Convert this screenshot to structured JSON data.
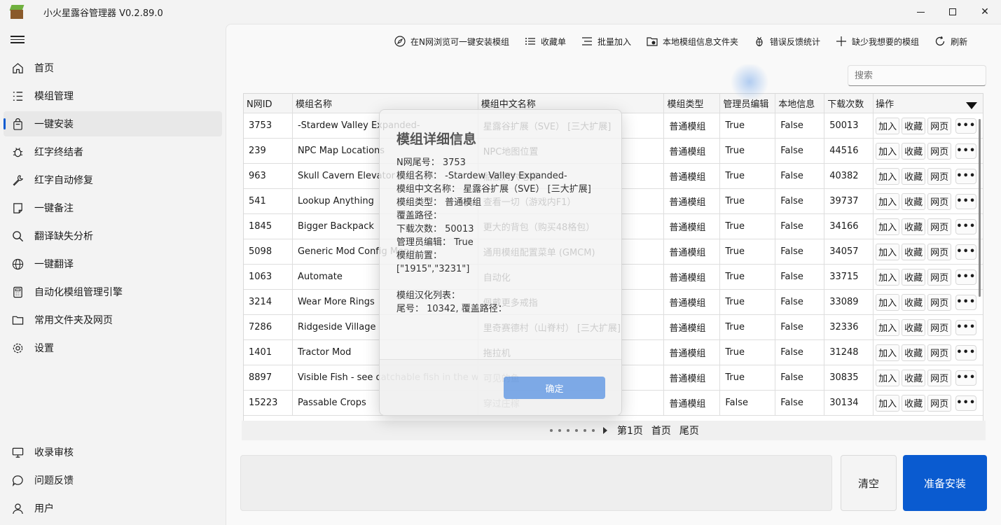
{
  "app": {
    "title": "小火星露谷管理器 V0.2.89.0"
  },
  "window_controls": {
    "close": "✕"
  },
  "nav": {
    "top": [
      {
        "label": "首页",
        "icon": "home-icon"
      },
      {
        "label": "模组管理",
        "icon": "list-icon"
      },
      {
        "label": "一键安装",
        "icon": "bag-icon",
        "active": true
      },
      {
        "label": "红字终结者",
        "icon": "bug-icon"
      },
      {
        "label": "红字自动修复",
        "icon": "wrench-icon"
      },
      {
        "label": "一键备注",
        "icon": "note-icon"
      },
      {
        "label": "翻译缺失分析",
        "icon": "search-icon"
      },
      {
        "label": "一键翻译",
        "icon": "globe-icon"
      },
      {
        "label": "自动化模组管理引擎",
        "icon": "calculator-icon"
      },
      {
        "label": "常用文件夹及网页",
        "icon": "folder-icon"
      },
      {
        "label": "设置",
        "icon": "gear-icon"
      }
    ],
    "bottom": [
      {
        "label": "收录审核",
        "icon": "monitor-icon"
      },
      {
        "label": "问题反馈",
        "icon": "chat-icon"
      },
      {
        "label": "用户",
        "icon": "user-icon"
      }
    ]
  },
  "toolbar": {
    "browse": "在N网浏览可一键安装模组",
    "favorites": "收藏单",
    "batch_add": "批量加入",
    "local_folder": "本地模组信息文件夹",
    "error_stats": "错误反馈统计",
    "missing": "缺少我想要的模组",
    "refresh": "刷新"
  },
  "search": {
    "placeholder": "搜索"
  },
  "table": {
    "headers": [
      "N网ID",
      "模组名称",
      "模组中文名称",
      "模组类型",
      "管理员编辑",
      "本地信息",
      "下载次数",
      "操作"
    ],
    "op_labels": {
      "add": "加入",
      "fav": "收藏",
      "web": "网页",
      "more": "•••"
    },
    "rows": [
      {
        "id": "3753",
        "name": "-Stardew Valley Expanded-",
        "cn": "星露谷扩展（SVE） [三大扩展]",
        "type": "普通模组",
        "admin": "True",
        "local": "False",
        "downloads": "50013"
      },
      {
        "id": "239",
        "name": "NPC Map Locations",
        "cn": "NPC地图位置",
        "type": "普通模组",
        "admin": "True",
        "local": "False",
        "downloads": "44516"
      },
      {
        "id": "963",
        "name": "Skull Cavern Elevator",
        "cn": "骷髅洞穴电梯",
        "type": "普通模组",
        "admin": "True",
        "local": "False",
        "downloads": "40382"
      },
      {
        "id": "541",
        "name": "Lookup Anything",
        "cn": "查看一切（游戏内F1）",
        "type": "普通模组",
        "admin": "True",
        "local": "False",
        "downloads": "39737"
      },
      {
        "id": "1845",
        "name": "Bigger Backpack",
        "cn": "更大的背包（购买48格包）",
        "type": "普通模组",
        "admin": "True",
        "local": "False",
        "downloads": "34166"
      },
      {
        "id": "5098",
        "name": "Generic Mod Config Menu",
        "cn": "通用模组配置菜单 (GMCM)",
        "type": "普通模组",
        "admin": "True",
        "local": "False",
        "downloads": "34057"
      },
      {
        "id": "1063",
        "name": "Automate",
        "cn": "自动化",
        "type": "普通模组",
        "admin": "True",
        "local": "False",
        "downloads": "33715"
      },
      {
        "id": "3214",
        "name": "Wear More Rings",
        "cn": "佩戴更多戒指",
        "type": "普通模组",
        "admin": "True",
        "local": "False",
        "downloads": "33089"
      },
      {
        "id": "7286",
        "name": "Ridgeside Village",
        "cn": "里奇赛德村（山脊村） [三大扩展]",
        "type": "普通模组",
        "admin": "True",
        "local": "False",
        "downloads": "32336"
      },
      {
        "id": "1401",
        "name": "Tractor Mod",
        "cn": "拖拉机",
        "type": "普通模组",
        "admin": "True",
        "local": "False",
        "downloads": "31248"
      },
      {
        "id": "8897",
        "name": "Visible Fish - see catchable fish in the water",
        "cn": "可见的鱼",
        "type": "普通模组",
        "admin": "True",
        "local": "False",
        "downloads": "30835"
      },
      {
        "id": "15223",
        "name": "Passable Crops",
        "cn": "穿过庄稼",
        "type": "普通模组",
        "admin": "False",
        "local": "False",
        "downloads": "30134"
      }
    ]
  },
  "pager": {
    "current": "第1页",
    "first": "首页",
    "last": "尾页"
  },
  "actions": {
    "clear": "清空",
    "install": "准备安装"
  },
  "dialog": {
    "title": "模组详细信息",
    "lines": [
      "N网尾号：  3753",
      "模组名称：  -Stardew Valley Expanded-",
      "模组中文名称：  星露谷扩展（SVE） [三大扩展]",
      "模组类型：  普通模组",
      "覆盖路径：",
      "下载次数：  50013",
      "管理员编辑：  True",
      "模组前置：",
      "[\"1915\",\"3231\"]",
      "",
      "模组汉化列表：",
      "尾号：  10342, 覆盖路径："
    ],
    "confirm": "确定"
  },
  "colors": {
    "accent": "#0a5bd0"
  }
}
